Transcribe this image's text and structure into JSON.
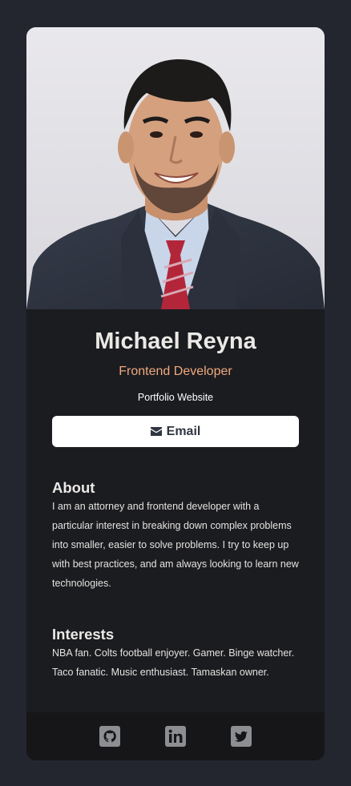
{
  "profile": {
    "name": "Michael Reyna",
    "role": "Frontend Developer",
    "portfolio_link": "Portfolio Website",
    "email_label": "Email",
    "photo_icon": "profile-photo"
  },
  "about": {
    "title": "About",
    "text": "I am an attorney and frontend developer with a particular interest in breaking down complex problems into smaller, easier to solve problems. I try to keep up with best practices, and am always looking to learn new technologies."
  },
  "interests": {
    "title": "Interests",
    "text": "NBA fan. Colts football enjoyer. Gamer. Binge watcher. Taco fanatic. Music enthusiast. Tamaskan owner."
  },
  "footer": {
    "links": [
      {
        "icon": "github-icon"
      },
      {
        "icon": "linkedin-icon"
      },
      {
        "icon": "twitter-icon"
      }
    ]
  },
  "colors": {
    "page_bg": "#23252f",
    "card_bg": "#1b1c20",
    "footer_bg": "#161619",
    "accent": "#f0a97f",
    "icon": "#8c8e92"
  }
}
